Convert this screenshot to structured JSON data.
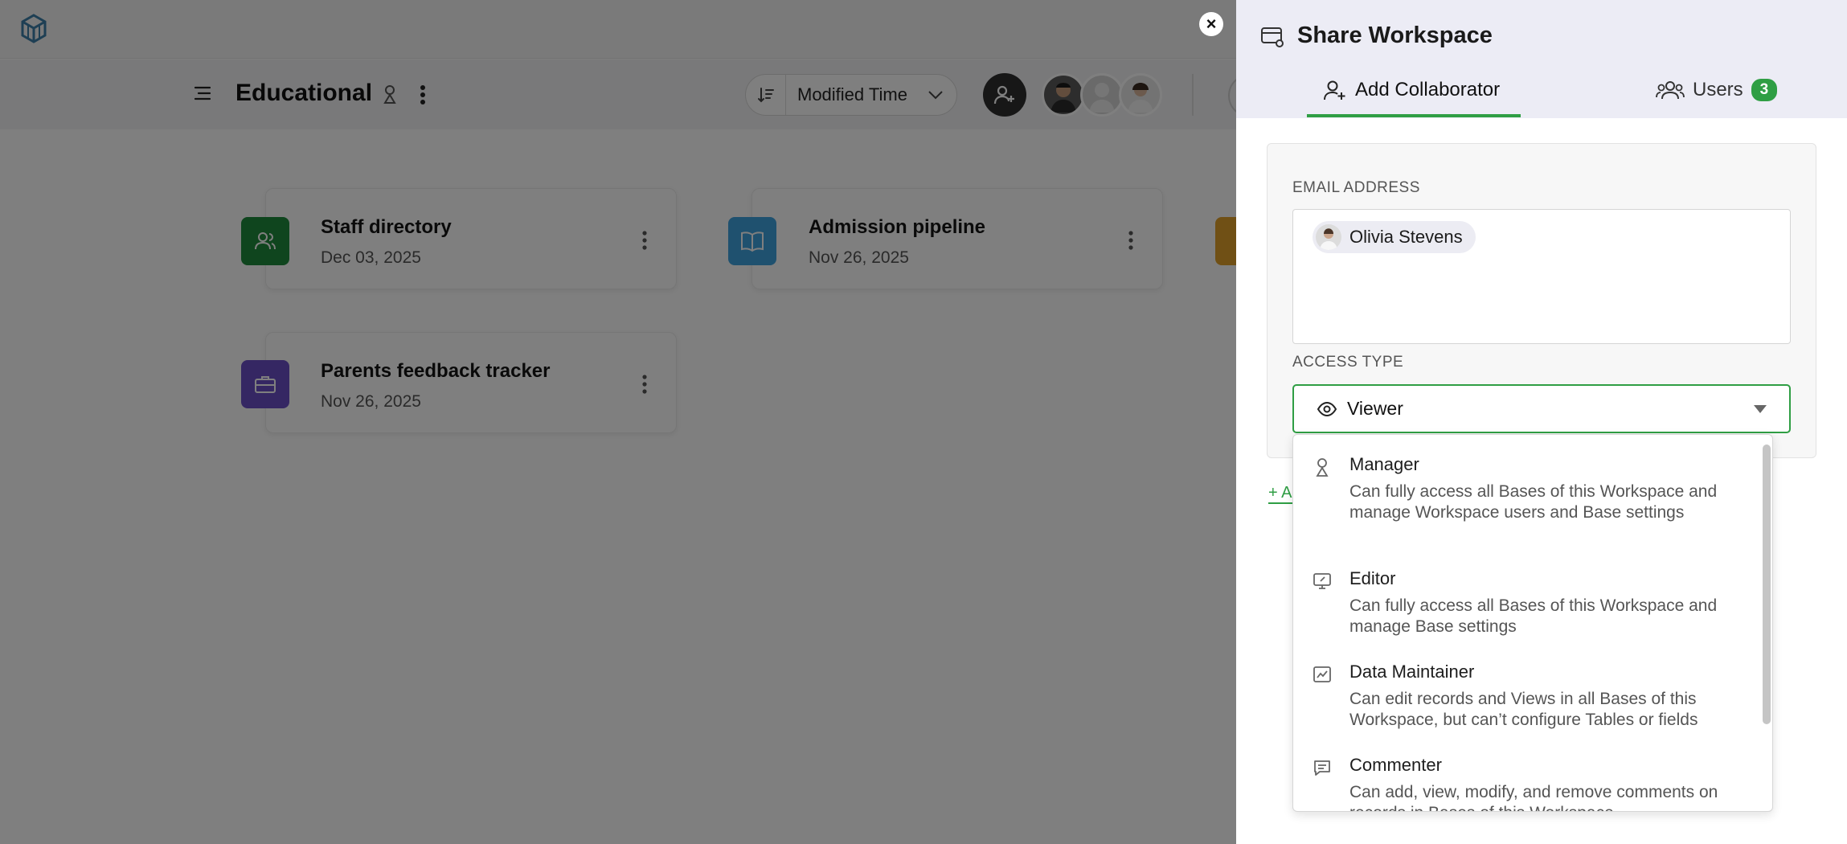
{
  "workspace": {
    "title": "Educational",
    "sort_label": "Modified Time"
  },
  "bases": [
    {
      "title": "Staff directory",
      "date": "Dec 03, 2025",
      "color": "#1e8a3c",
      "icon": "users-icon"
    },
    {
      "title": "Admission pipeline",
      "date": "Nov 26, 2025",
      "color": "#3fa2de",
      "icon": "book-icon"
    },
    {
      "title": "Parents feedback tracker",
      "date": "Nov 26, 2025",
      "color": "#6b4fc7",
      "icon": "briefcase-icon"
    }
  ],
  "share_panel": {
    "title": "Share Workspace",
    "tabs": {
      "add_collaborator": "Add Collaborator",
      "users": "Users",
      "users_count": "3"
    },
    "email_label": "EMAIL ADDRESS",
    "chip_name": "Olivia Stevens",
    "access_label": "ACCESS TYPE",
    "access_value": "Viewer",
    "add_link": "+ A",
    "options": [
      {
        "name": "Manager",
        "desc": "Can fully access all Bases of this Workspace and manage Workspace users and Base settings",
        "icon": "manager-icon"
      },
      {
        "name": "Editor",
        "desc": "Can fully access all Bases of this Workspace and manage Base settings",
        "icon": "editor-icon"
      },
      {
        "name": "Data Maintainer",
        "desc": "Can edit records and Views in all Bases of this Workspace, but can’t configure Tables or fields",
        "icon": "data-maintainer-icon"
      },
      {
        "name": "Commenter",
        "desc": "Can add, view, modify, and remove comments on records in Bases of this Workspace",
        "icon": "commenter-icon"
      }
    ]
  },
  "colors": {
    "accent": "#2f9e44",
    "overlay": "rgba(0,0,0,0.5)"
  }
}
